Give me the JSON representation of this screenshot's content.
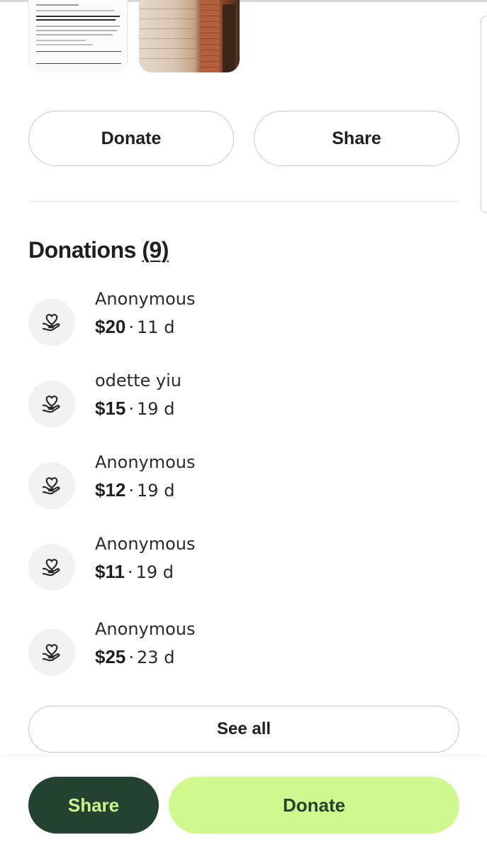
{
  "actions": {
    "donate_label": "Donate",
    "share_label": "Share"
  },
  "donations": {
    "title": "Donations",
    "count": "(9)",
    "items": [
      {
        "name": "Anonymous",
        "amount": "$20",
        "age": "11 d"
      },
      {
        "name": "odette yiu",
        "amount": "$15",
        "age": "19 d"
      },
      {
        "name": "Anonymous",
        "amount": "$12",
        "age": "19 d"
      },
      {
        "name": "Anonymous",
        "amount": "$11",
        "age": "19 d"
      },
      {
        "name": "Anonymous",
        "amount": "$25",
        "age": "23 d"
      }
    ],
    "see_all_label": "See all"
  },
  "bottom_bar": {
    "share_label": "Share",
    "donate_label": "Donate"
  },
  "icons": {
    "donation": "hand-heart-icon"
  },
  "colors": {
    "primary_dark": "#234232",
    "primary_light": "#cff98f",
    "accent_text": "#cef28c"
  }
}
